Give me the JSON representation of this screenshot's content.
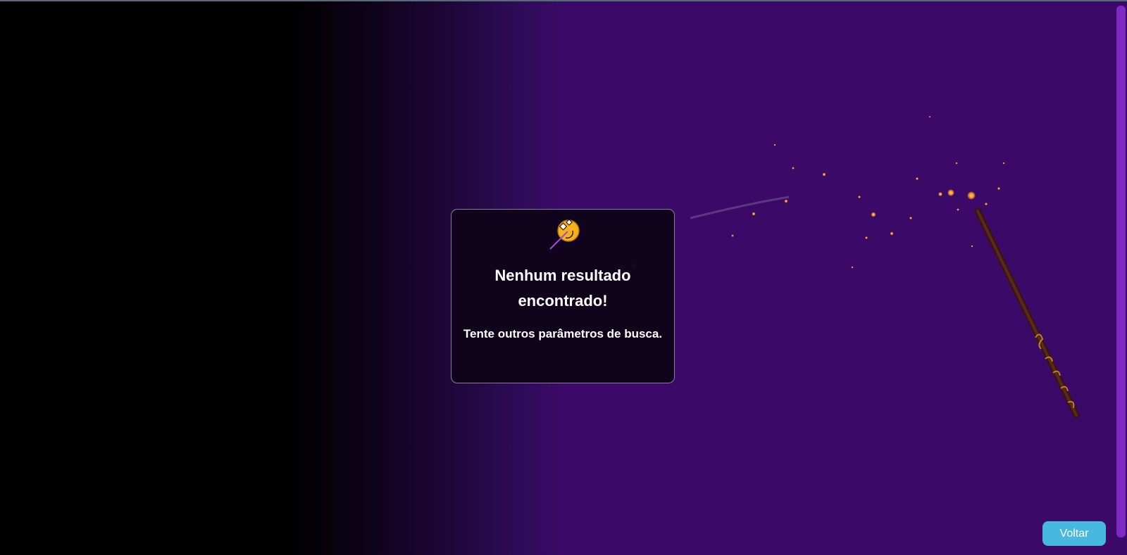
{
  "modal": {
    "icon": "magic-wand-icon",
    "title": "Nenhum resultado encontrado!",
    "subtitle": "Tente outros parâmetros de busca."
  },
  "actions": {
    "back_label": "Voltar"
  },
  "colors": {
    "background": "#3b0a68",
    "button": "#47b9e0",
    "scrollbar": "#7d2ac4",
    "icon_accent": "#f6b21a"
  }
}
